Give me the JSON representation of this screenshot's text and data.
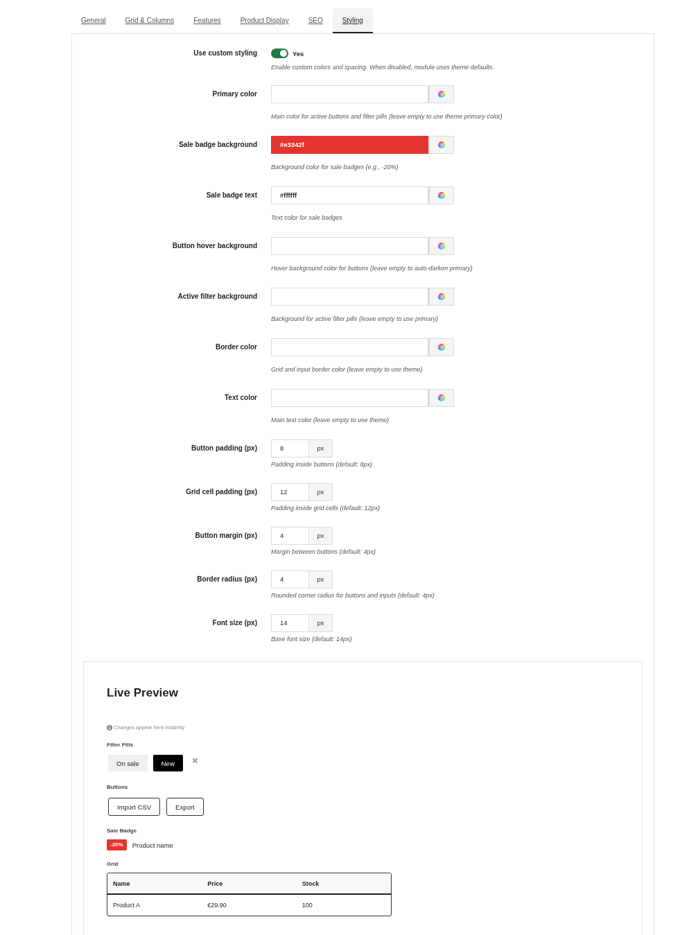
{
  "tabs": [
    {
      "label": "General",
      "selected": false
    },
    {
      "label": "Grid & Columns",
      "selected": false
    },
    {
      "label": "Features",
      "selected": false
    },
    {
      "label": "Product Display",
      "selected": false
    },
    {
      "label": "SEO",
      "selected": false
    },
    {
      "label": "Styling",
      "selected": true
    }
  ],
  "settings": [
    {
      "kind": "toggle",
      "label": "Use custom styling",
      "on": true,
      "state_label": "Yes",
      "help": "Enable custom colors and spacing. When disabled, module uses theme defaults."
    },
    {
      "kind": "color",
      "label": "Primary color",
      "help": "Main color for active buttons and filter pills (leave empty to use theme primary color)"
    },
    {
      "kind": "color",
      "label": "Sale badge background",
      "value": "#e3342f",
      "color": "#e3342f",
      "help": "Background color for sale badges (e.g., -20%)"
    },
    {
      "kind": "color",
      "label": "Sale badge text",
      "value": "#ffffff",
      "help": "Text color for sale badges"
    },
    {
      "kind": "color",
      "label": "Button hover background",
      "help": "Hover background color for buttons (leave empty to auto-darken primary)"
    },
    {
      "kind": "color",
      "label": "Active filter background",
      "help": "Background for active filter pills (leave empty to use primary)"
    },
    {
      "kind": "color",
      "label": "Border color",
      "help": "Grid and input border color (leave empty to use theme)"
    },
    {
      "kind": "color",
      "label": "Text color",
      "help": "Main text color (leave empty to use theme)"
    },
    {
      "kind": "number",
      "label": "Button padding (px)",
      "value": "8",
      "unit": "px",
      "help": "Padding inside buttons (default: 8px)"
    },
    {
      "kind": "number",
      "label": "Grid cell padding (px)",
      "value": "12",
      "unit": "px",
      "help": "Padding inside grid cells (default: 12px)"
    },
    {
      "kind": "number",
      "label": "Button margin (px)",
      "value": "4",
      "unit": "px",
      "help": "Margin between buttons (default: 4px)"
    },
    {
      "kind": "number",
      "label": "Border radius (px)",
      "value": "4",
      "unit": "px",
      "help": "Rounded corner radius for buttons and inputs (default: 4px)"
    },
    {
      "kind": "number",
      "label": "Font size (px)",
      "value": "14",
      "unit": "px",
      "help": "Base font size (default: 14px)"
    }
  ],
  "preview": {
    "title": "Live Preview",
    "note": "Changes appear here instantly",
    "filter_pills": {
      "heading": "Filter Pills",
      "pills": [
        {
          "label": "On sale",
          "selected": false
        },
        {
          "label": "New",
          "selected": true
        }
      ]
    },
    "buttons": {
      "heading": "Buttons",
      "items": [
        "Import CSV",
        "Export"
      ]
    },
    "sale_badge": {
      "heading": "Sale Badge",
      "badge": "-20%",
      "product": "Product name"
    },
    "grid": {
      "heading": "Grid",
      "columns": [
        "Name",
        "Price",
        "Stock"
      ],
      "rows": [
        [
          "Product A",
          "€29.90",
          "100"
        ]
      ]
    }
  }
}
